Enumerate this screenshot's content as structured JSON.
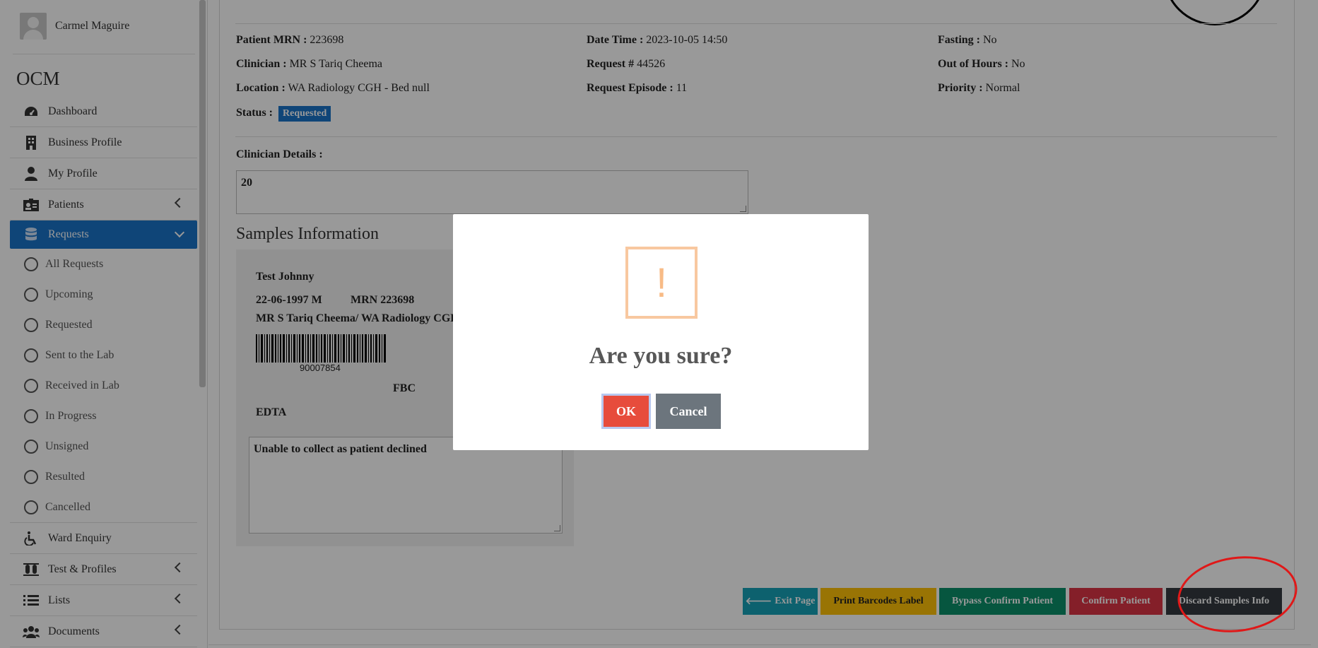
{
  "sidebar": {
    "user_name": "Carmel Maguire",
    "brand": "OCM",
    "items": [
      {
        "label": "Dashboard",
        "icon": "dashboard-icon"
      },
      {
        "label": "Business Profile",
        "icon": "building-icon"
      },
      {
        "label": "My Profile",
        "icon": "user-icon"
      },
      {
        "label": "Patients",
        "icon": "id-badge-icon"
      },
      {
        "label": "Requests",
        "icon": "database-icon"
      },
      {
        "label": "Ward Enquiry",
        "icon": "wheelchair-icon"
      },
      {
        "label": "Test & Profiles",
        "icon": "test-tubes-icon"
      },
      {
        "label": "Lists",
        "icon": "list-icon"
      },
      {
        "label": "Documents",
        "icon": "users-icon"
      }
    ],
    "request_subitems": [
      "All Requests",
      "Upcoming",
      "Requested",
      "Sent to the Lab",
      "Received in Lab",
      "In Progress",
      "Unsigned",
      "Resulted",
      "Cancelled"
    ]
  },
  "info": {
    "patient_mrn_label": "Patient MRN :",
    "patient_mrn": "223698",
    "clinician_label": "Clinician :",
    "clinician": "MR S Tariq Cheema",
    "location_label": "Location :",
    "location": "WA Radiology CGH - Bed null",
    "status_label": "Status :",
    "status": "Requested",
    "datetime_label": "Date Time :",
    "datetime": "2023-10-05 14:50",
    "request_label": "Request #",
    "request_no": "44526",
    "episode_label": "Request Episode :",
    "episode": "11",
    "fasting_label": "Fasting :",
    "fasting": "No",
    "out_of_hours_label": "Out of Hours :",
    "out_of_hours": "No",
    "priority_label": "Priority :",
    "priority": "Normal"
  },
  "clinician_details": {
    "label": "Clinician Details :",
    "value": "20"
  },
  "samples": {
    "title": "Samples Information",
    "patient_name": "Test Johnny",
    "dob_sex": "22-06-1997 M",
    "mrn": "MRN 223698",
    "clinician_location": "MR S Tariq Cheema/ WA Radiology CGH",
    "barcode_number": "90007854",
    "test": "FBC",
    "tube": "EDTA",
    "reason": "Unable to collect as patient declined"
  },
  "actions": {
    "exit": "Exit Page",
    "print": "Print Barcodes Label",
    "bypass": "Bypass Confirm Patient",
    "confirm": "Confirm Patient",
    "discard": "Discard Samples Info"
  },
  "dialog": {
    "icon_glyph": "!",
    "title": "Are you sure?",
    "ok": "OK",
    "cancel": "Cancel"
  },
  "colors": {
    "primary": "#1a73c9",
    "info": "#17a2b8",
    "warning": "#ffc107",
    "success": "#0a8f6a",
    "danger": "#dc3545",
    "dark": "#343a40",
    "ok": "#e74c3c",
    "cancel": "#6c757d",
    "warn_icon": "#f8bb86"
  }
}
